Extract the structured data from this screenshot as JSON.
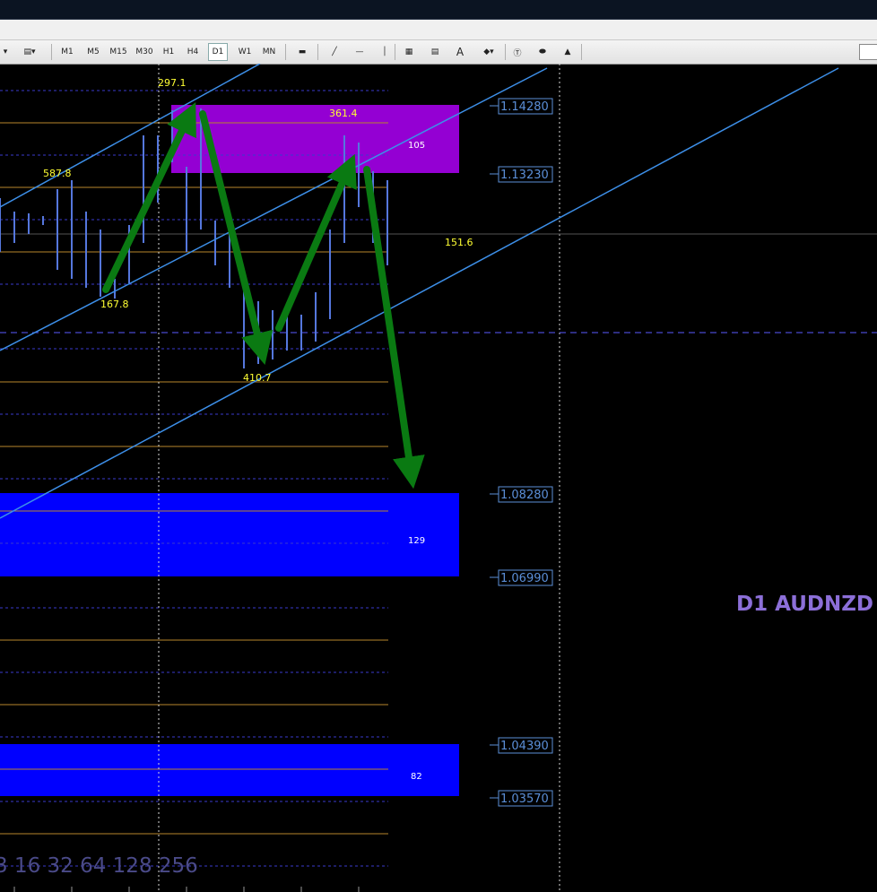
{
  "toolbar": {
    "timeframes": [
      "M1",
      "M5",
      "M15",
      "M30",
      "H1",
      "H4",
      "D1",
      "W1",
      "MN"
    ],
    "active_timeframe": "D1"
  },
  "chart": {
    "symbol_label": "D1 AUDNZD",
    "price_labels": [
      "1.14280",
      "1.13230",
      "1.08280",
      "1.06990",
      "1.04390",
      "1.03570"
    ],
    "swing_labels": [
      "297.1",
      "361.4",
      "587.8",
      "151.6",
      "167.8",
      "410.7"
    ],
    "zone_labels": [
      "105",
      "129",
      "82"
    ],
    "fib_sequence": "3 16 32 64 128 256",
    "colors": {
      "supply_zone": "#9400d3",
      "demand_zone": "#0000ff",
      "arrow": "#0a7a12",
      "channel": "#3d8fe8",
      "candle": "#5577dd",
      "price_label": "#5b8fd8",
      "level_orange": "#b8862b",
      "level_dashed": "#3a3acc"
    }
  }
}
